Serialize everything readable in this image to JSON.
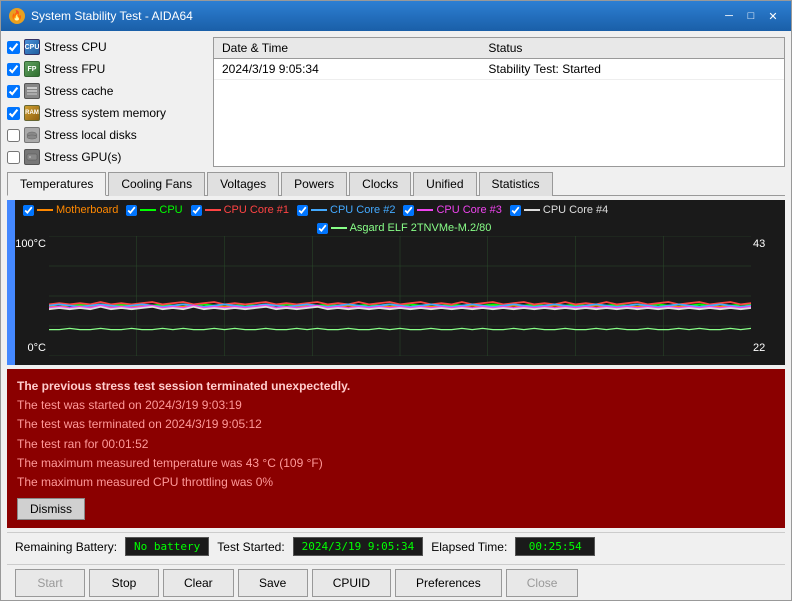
{
  "window": {
    "title": "System Stability Test - AIDA64",
    "icon": "🔥"
  },
  "titlebar": {
    "minimize": "─",
    "maximize": "□",
    "close": "✕"
  },
  "stress_options": [
    {
      "id": "cpu",
      "label": "Stress CPU",
      "checked": true,
      "icon_type": "cpu"
    },
    {
      "id": "fpu",
      "label": "Stress FPU",
      "checked": true,
      "icon_type": "fpu"
    },
    {
      "id": "cache",
      "label": "Stress cache",
      "checked": true,
      "icon_type": "cache"
    },
    {
      "id": "memory",
      "label": "Stress system memory",
      "checked": true,
      "icon_type": "mem"
    },
    {
      "id": "disk",
      "label": "Stress local disks",
      "checked": false,
      "icon_type": "disk"
    },
    {
      "id": "gpu",
      "label": "Stress GPU(s)",
      "checked": false,
      "icon_type": "gpu"
    }
  ],
  "log_table": {
    "columns": [
      "Date & Time",
      "Status"
    ],
    "rows": [
      {
        "datetime": "2024/3/19 9:05:34",
        "status": "Stability Test: Started"
      }
    ]
  },
  "tabs": [
    {
      "id": "temperatures",
      "label": "Temperatures",
      "active": true
    },
    {
      "id": "cooling-fans",
      "label": "Cooling Fans",
      "active": false
    },
    {
      "id": "voltages",
      "label": "Voltages",
      "active": false
    },
    {
      "id": "powers",
      "label": "Powers",
      "active": false
    },
    {
      "id": "clocks",
      "label": "Clocks",
      "active": false
    },
    {
      "id": "unified",
      "label": "Unified",
      "active": false
    },
    {
      "id": "statistics",
      "label": "Statistics",
      "active": false
    }
  ],
  "chart": {
    "legend": [
      {
        "id": "motherboard",
        "label": "Motherboard",
        "color": "#ff8800"
      },
      {
        "id": "cpu",
        "label": "CPU",
        "color": "#00ff00"
      },
      {
        "id": "core1",
        "label": "CPU Core #1",
        "color": "#ff4444"
      },
      {
        "id": "core2",
        "label": "CPU Core #2",
        "color": "#44aaff"
      },
      {
        "id": "core3",
        "label": "CPU Core #3",
        "color": "#ee44ee"
      },
      {
        "id": "core4",
        "label": "CPU Core #4",
        "color": "#dddddd"
      }
    ],
    "legend2": [
      {
        "id": "ssd",
        "label": "Asgard ELF 2TNVMe-M.2/80",
        "color": "#88ff88"
      }
    ],
    "y_axis": {
      "top": "100°C",
      "bottom": "0°C"
    },
    "y_values": {
      "top": "43",
      "bottom": "22"
    }
  },
  "alert": {
    "lines": [
      "The previous stress test session terminated unexpectedly.",
      "The test was started on 2024/3/19 9:03:19",
      "The test was terminated on 2024/3/19 9:05:12",
      "The test ran for 00:01:52",
      "The maximum measured temperature was 43 °C  (109 °F)",
      "The maximum measured CPU throttling was 0%"
    ],
    "dismiss_label": "Dismiss"
  },
  "status_bar": {
    "battery_label": "Remaining Battery:",
    "battery_value": "No battery",
    "test_started_label": "Test Started:",
    "test_started_value": "2024/3/19 9:05:34",
    "elapsed_label": "Elapsed Time:",
    "elapsed_value": "00:25:54"
  },
  "buttons": {
    "start": "Start",
    "stop": "Stop",
    "clear": "Clear",
    "save": "Save",
    "cpuid": "CPUID",
    "preferences": "Preferences",
    "close": "Close"
  }
}
